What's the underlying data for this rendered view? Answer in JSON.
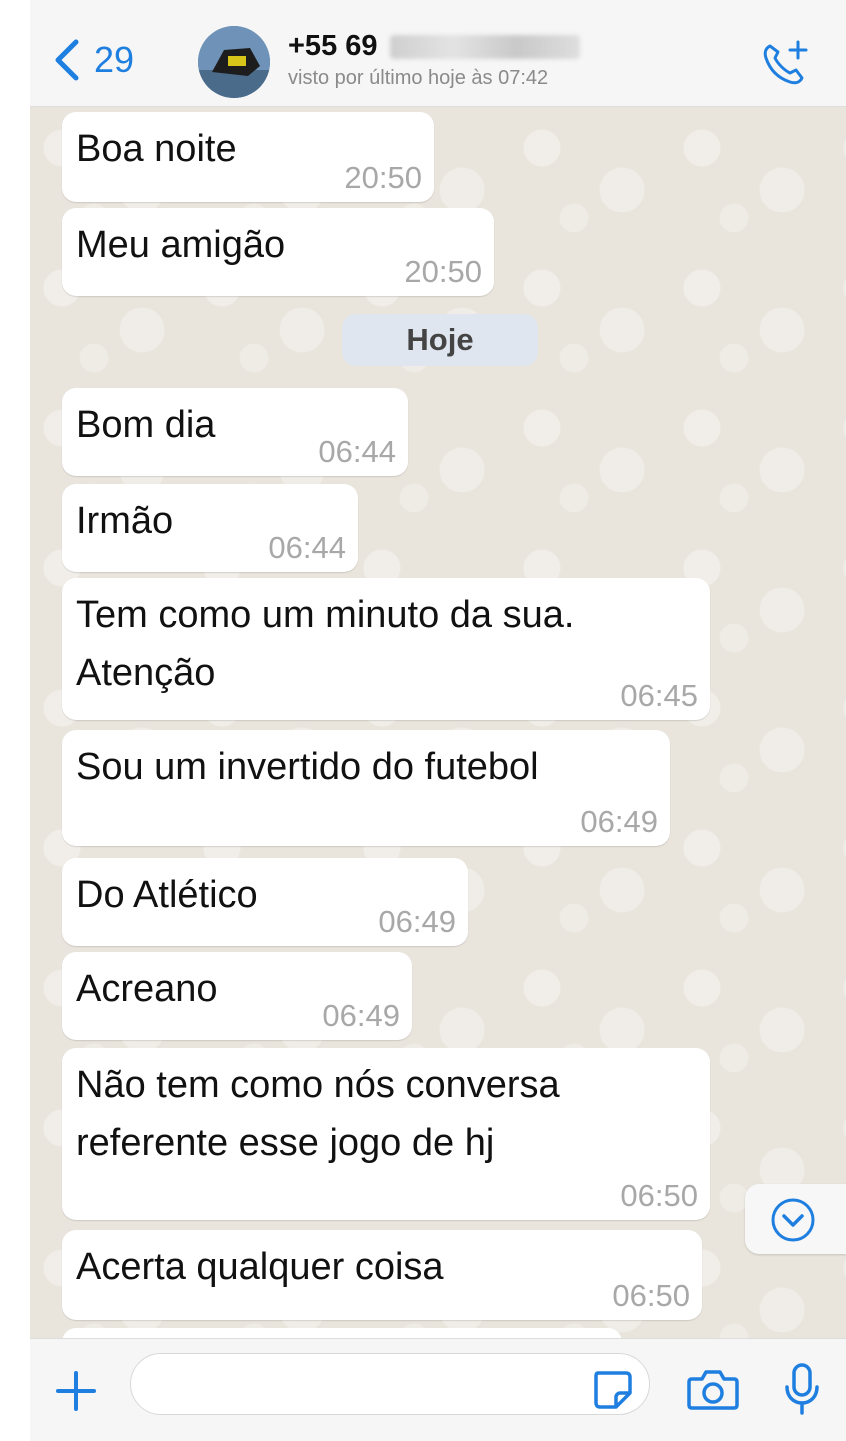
{
  "header": {
    "back_count": "29",
    "contact_number": "+55 69",
    "last_seen": "visto por último hoje às 07:42"
  },
  "day_divider": "Hoje",
  "messages": [
    {
      "text": "Boa noite",
      "time": "20:50"
    },
    {
      "text": "Meu amigão",
      "time": "20:50"
    },
    {
      "text": "Bom dia",
      "time": "06:44"
    },
    {
      "text": "Irmão",
      "time": "06:44"
    },
    {
      "text": "Tem como um minuto da sua.",
      "text2": "Atenção",
      "time": "06:45"
    },
    {
      "text": "Sou um invertido do futebol",
      "time": "06:49"
    },
    {
      "text": "Do Atlético",
      "time": "06:49"
    },
    {
      "text": "Acreano",
      "time": "06:49"
    },
    {
      "text": "Não tem como nós conversa",
      "text2": "referente esse jogo de hj",
      "time": "06:50"
    },
    {
      "text": "Acerta qualquer coisa",
      "time": "06:50"
    }
  ],
  "colors": {
    "accent": "#1f7fe0",
    "bubble": "#ffffff",
    "wallpaper": "#e9e4dc",
    "timestamp": "#a8a8a8"
  },
  "icons": [
    "chevron-left-icon",
    "call-add-icon",
    "chevron-down-icon",
    "plus-icon",
    "sticker-icon",
    "camera-icon",
    "microphone-icon"
  ]
}
